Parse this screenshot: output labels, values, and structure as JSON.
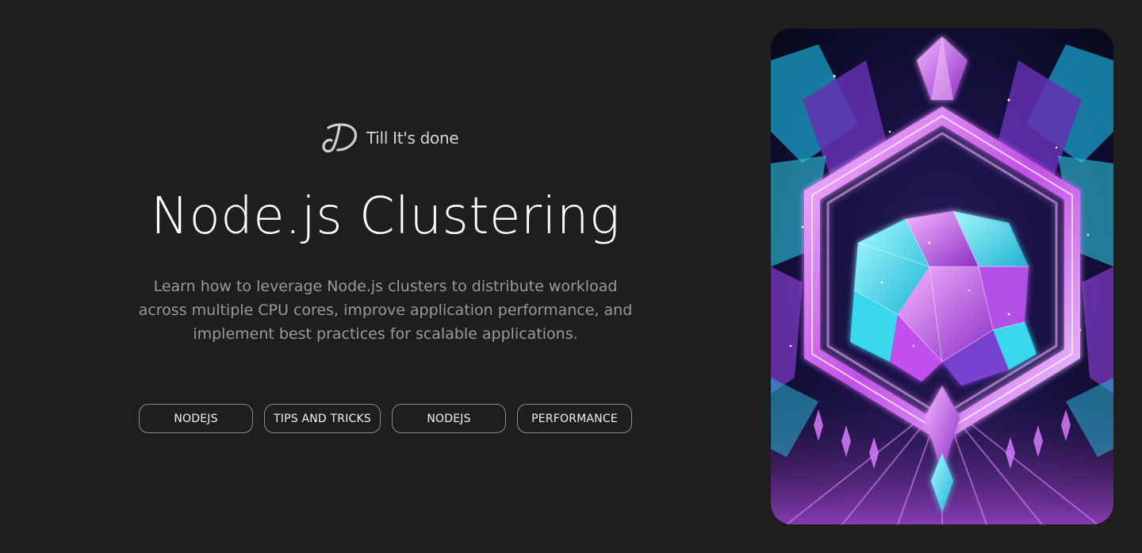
{
  "brand": {
    "logo_icon": "brand-logo-icon",
    "name": "Till It's done"
  },
  "hero": {
    "title": "Node.js Clustering",
    "description": "Learn how to leverage Node.js clusters to distribute workload across multiple CPU cores, improve application performance, and implement best practices for scalable applications."
  },
  "tags": [
    {
      "label": "NODEJS"
    },
    {
      "label": "TIPS AND TRICKS"
    },
    {
      "label": "NODEJS"
    },
    {
      "label": "PERFORMANCE"
    }
  ],
  "image": {
    "subject": "crystal-hexagon-artwork",
    "colors": {
      "background": "#0c0d2a",
      "magenta": "#d04ff0",
      "cyan": "#39e3f0",
      "violet": "#7a3fd0"
    }
  },
  "colors": {
    "page_background": "#1e1e1e",
    "title": "#ffffff",
    "description": "#9a9a9a",
    "tag_border": "#8d8d8d"
  }
}
